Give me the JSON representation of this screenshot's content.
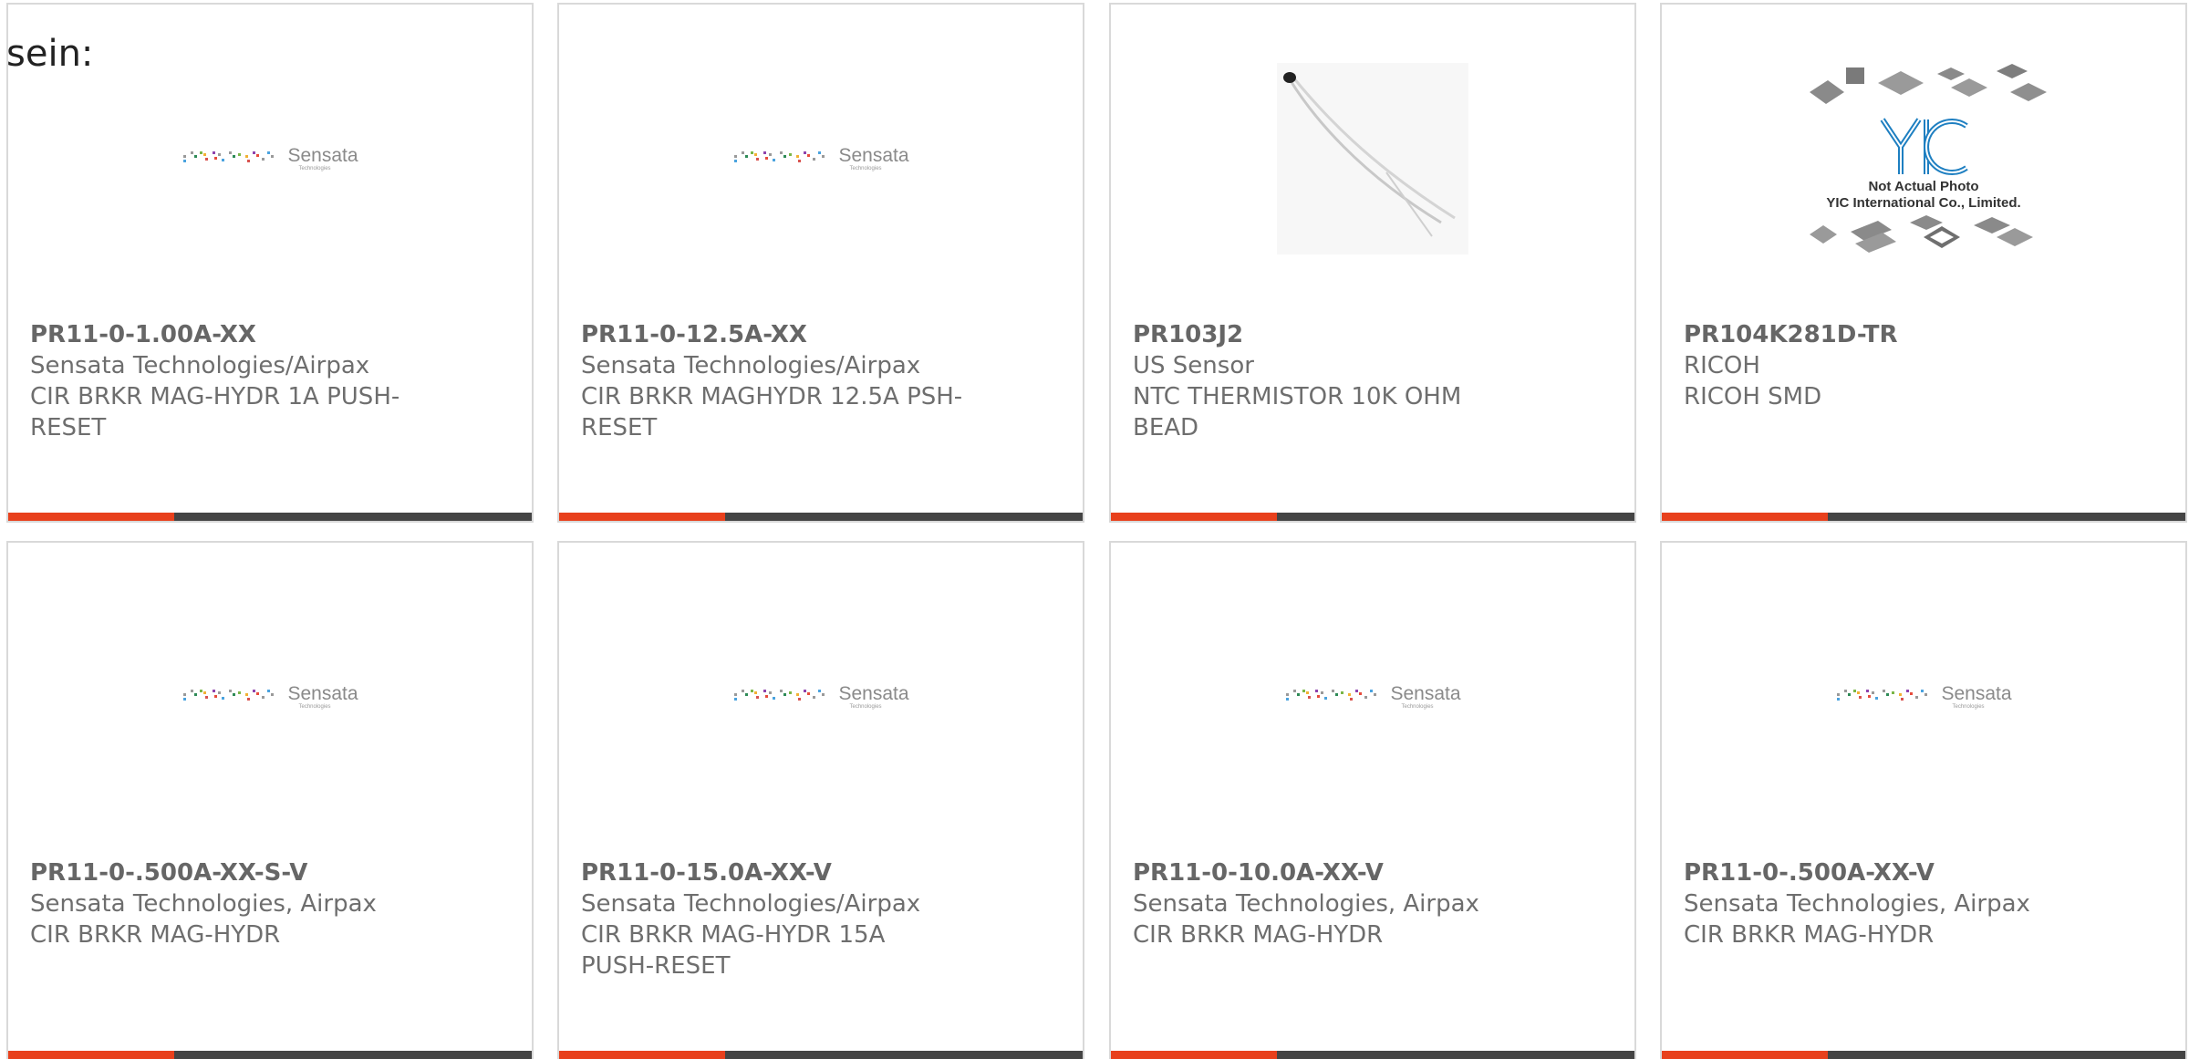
{
  "page": {
    "overflow_text": "sein:"
  },
  "products": [
    {
      "part_number": "PR11-0-1.00A-XX",
      "manufacturer": "Sensata Technologies/Airpax",
      "description": "CIR BRKR MAG-HYDR 1A PUSH-RESET",
      "image": "sensata-logo"
    },
    {
      "part_number": "PR11-0-12.5A-XX",
      "manufacturer": "Sensata Technologies/Airpax",
      "description": "CIR BRKR MAGHYDR 12.5A PSH-RESET",
      "image": "sensata-logo"
    },
    {
      "part_number": "PR103J2",
      "manufacturer": "US Sensor",
      "description": "NTC THERMISTOR 10K OHM BEAD",
      "image": "thermistor-photo"
    },
    {
      "part_number": "PR104K281D-TR",
      "manufacturer": "RICOH",
      "description": "RICOH SMD",
      "image": "yic-placeholder"
    },
    {
      "part_number": "PR11-0-.500A-XX-S-V",
      "manufacturer": "Sensata Technologies, Airpax",
      "description": "CIR BRKR MAG-HYDR",
      "image": "sensata-logo"
    },
    {
      "part_number": "PR11-0-15.0A-XX-V",
      "manufacturer": "Sensata Technologies/Airpax",
      "description": "CIR BRKR MAG-HYDR 15A PUSH-RESET",
      "image": "sensata-logo"
    },
    {
      "part_number": "PR11-0-10.0A-XX-V",
      "manufacturer": "Sensata Technologies, Airpax",
      "description": "CIR BRKR MAG-HYDR",
      "image": "sensata-logo"
    },
    {
      "part_number": "PR11-0-.500A-XX-V",
      "manufacturer": "Sensata Technologies, Airpax",
      "description": "CIR BRKR MAG-HYDR",
      "image": "sensata-logo"
    }
  ],
  "logos": {
    "sensata_name": "Sensata",
    "sensata_sub": "Technologies",
    "yic_caption_line1": "Not Actual Photo",
    "yic_caption_line2": "YIC International Co., Limited."
  },
  "colors": {
    "accent": "#e8401c",
    "bar": "#444444",
    "border": "#d9d9d9",
    "text": "#6e6e6e"
  }
}
